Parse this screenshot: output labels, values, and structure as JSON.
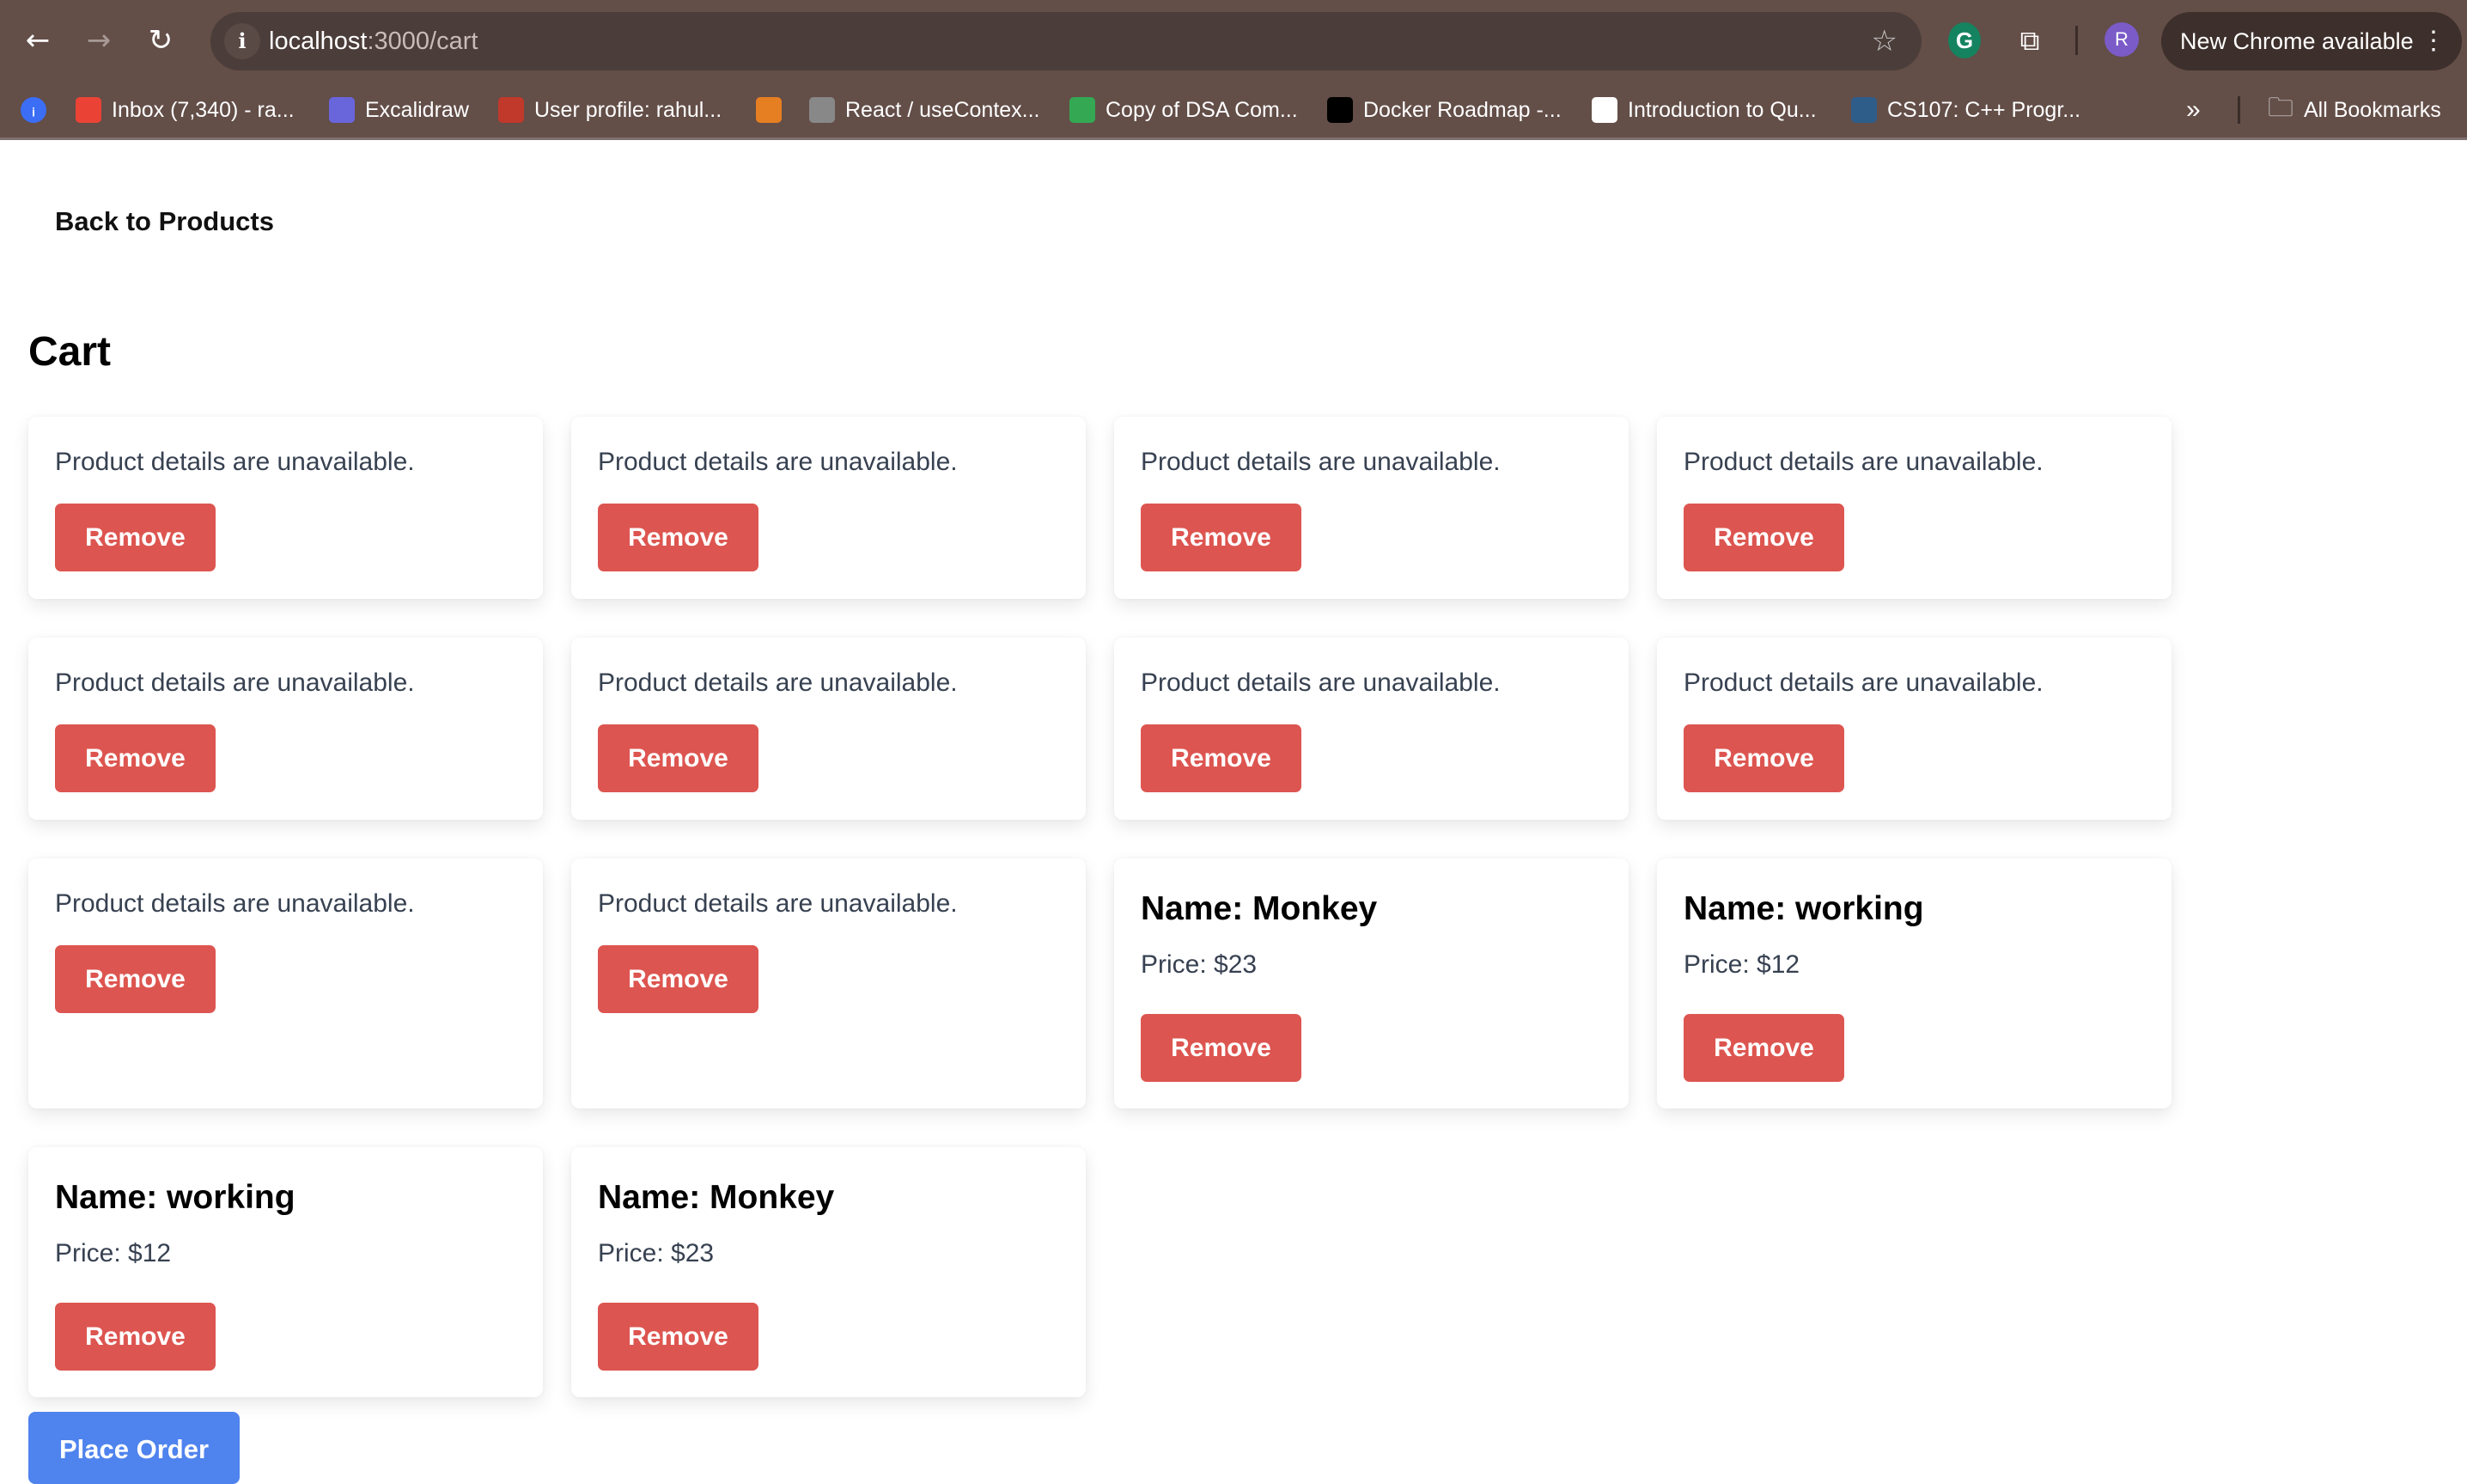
{
  "browser": {
    "url_host": "localhost",
    "url_path": ":3000/cart",
    "new_chrome_label": "New Chrome available",
    "avatar_letter": "R",
    "grammarly_letter": "G",
    "bookmarks": [
      {
        "label": "Inbox (7,340) - ra...",
        "icon": "gmail-icon",
        "color": "#ea4335"
      },
      {
        "label": "Excalidraw",
        "icon": "excalidraw-icon",
        "color": "#6965db"
      },
      {
        "label": "User profile: rahul...",
        "icon": "stalk-icon",
        "color": "#c0392b"
      },
      {
        "label": "",
        "icon": "codechef-icon",
        "color": "#e67e22"
      },
      {
        "label": "React / useContex...",
        "icon": "search-icon",
        "color": "#888888"
      },
      {
        "label": "Copy of DSA Com...",
        "icon": "sheets-icon",
        "color": "#34a853"
      },
      {
        "label": "Docker Roadmap -...",
        "icon": "roadmap-icon",
        "color": "#000000"
      },
      {
        "label": "Introduction to Qu...",
        "icon": "globe-icon",
        "color": "#ffffff"
      },
      {
        "label": "CS107: C++ Progr...",
        "icon": "cs107-icon",
        "color": "#2f5d8a"
      }
    ],
    "all_bookmarks_label": "All Bookmarks"
  },
  "page": {
    "back_link": "Back to Products",
    "title": "Cart",
    "remove_label": "Remove",
    "place_order_label": "Place Order",
    "items": [
      {
        "message": "Product details are unavailable."
      },
      {
        "message": "Product details are unavailable."
      },
      {
        "message": "Product details are unavailable."
      },
      {
        "message": "Product details are unavailable."
      },
      {
        "message": "Product details are unavailable."
      },
      {
        "message": "Product details are unavailable."
      },
      {
        "message": "Product details are unavailable."
      },
      {
        "message": "Product details are unavailable."
      },
      {
        "message": "Product details are unavailable."
      },
      {
        "message": "Product details are unavailable."
      },
      {
        "name": "Name: Monkey",
        "price": "Price: $23"
      },
      {
        "name": "Name: working",
        "price": "Price: $12"
      },
      {
        "name": "Name: working",
        "price": "Price: $12"
      },
      {
        "name": "Name: Monkey",
        "price": "Price: $23"
      }
    ]
  },
  "colors": {
    "remove": "#dd5550",
    "place_order": "#4f83ee",
    "chrome": "#634e48"
  }
}
